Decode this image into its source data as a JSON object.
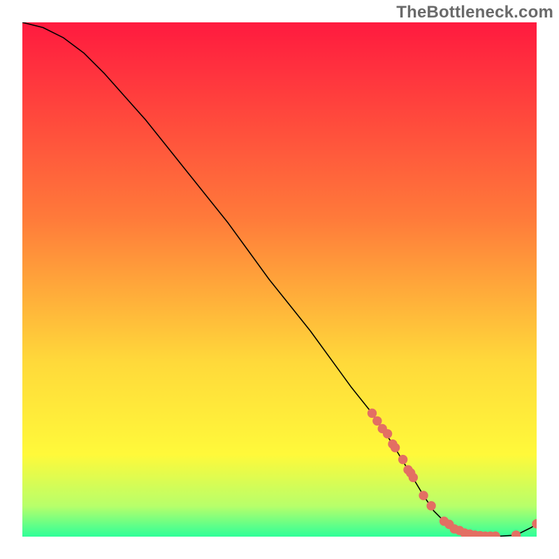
{
  "watermark": "TheBottleneck.com",
  "chart_data": {
    "type": "line",
    "title": "",
    "xlabel": "",
    "ylabel": "",
    "xlim": [
      0,
      100
    ],
    "ylim": [
      0,
      100
    ],
    "x": [
      0,
      4,
      8,
      12,
      16,
      20,
      24,
      28,
      32,
      36,
      40,
      44,
      48,
      52,
      56,
      60,
      64,
      68,
      72,
      75,
      78,
      80,
      82,
      84,
      86,
      88,
      90,
      93,
      96,
      99,
      100
    ],
    "values": [
      100,
      99,
      97,
      94,
      90,
      85.5,
      81,
      76,
      71,
      66,
      61,
      55.5,
      50,
      45,
      40,
      34.5,
      29,
      24,
      18,
      13,
      8,
      5,
      3,
      1.5,
      0.7,
      0.3,
      0.1,
      0.1,
      0.3,
      1.8,
      2.5
    ],
    "markers_x": [
      68,
      69,
      70,
      71,
      72,
      72.5,
      74,
      75,
      75.5,
      76,
      78,
      79.5,
      82,
      83,
      84,
      85,
      86,
      87,
      88,
      89,
      90,
      91,
      92,
      96,
      100
    ],
    "markers_y": [
      24,
      22.5,
      21,
      20,
      18,
      17.3,
      15,
      13,
      12.4,
      11.5,
      8,
      6,
      3,
      2.4,
      1.5,
      1.2,
      0.7,
      0.5,
      0.3,
      0.2,
      0.1,
      0.1,
      0.1,
      0.3,
      2.5
    ],
    "gradient_colors": {
      "top": "#ff1a3f",
      "mid1": "#ff7a3a",
      "mid2": "#ffd93a",
      "low1": "#fff93a",
      "low2": "#b8ff6a",
      "bottom": "#2fff99"
    }
  }
}
